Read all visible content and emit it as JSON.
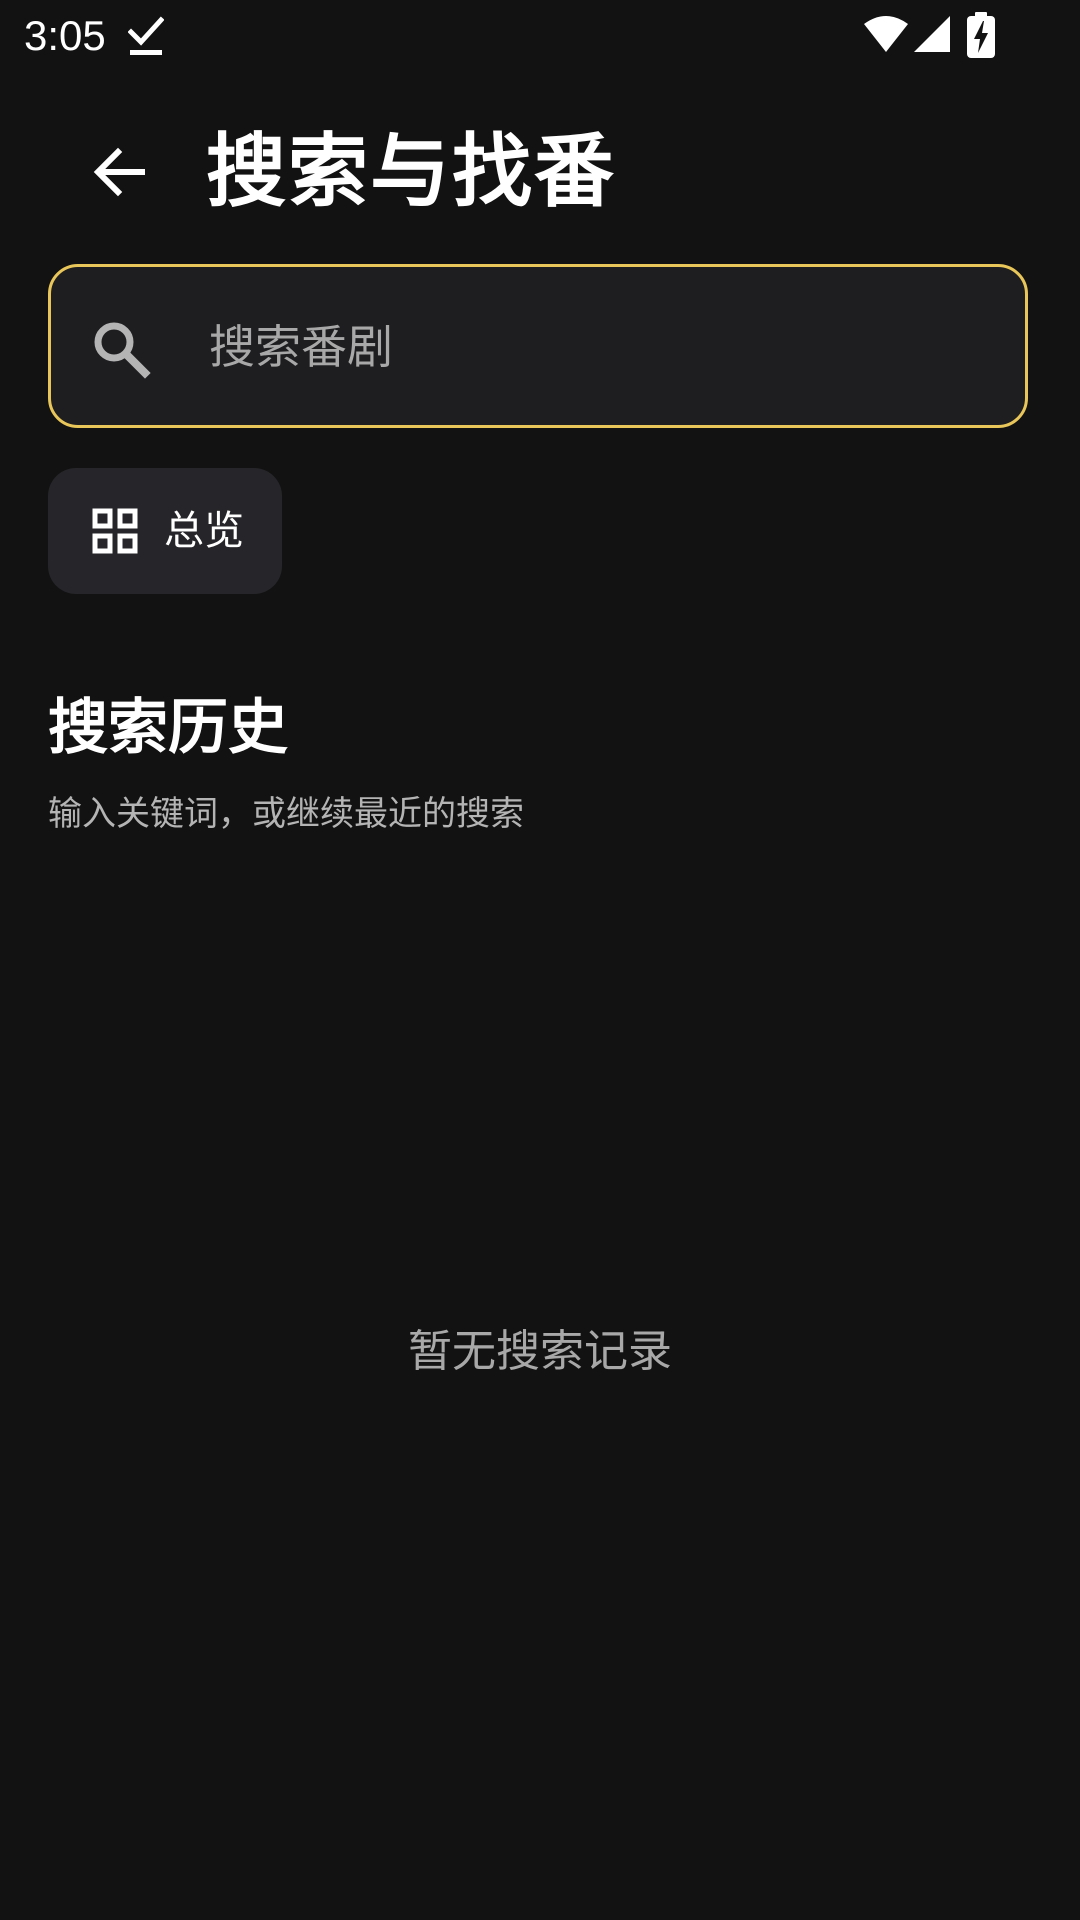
{
  "status_bar": {
    "time": "3:05",
    "icons": [
      "download-done-icon",
      "wifi-icon",
      "cellular-signal-icon",
      "battery-charging-icon"
    ]
  },
  "header": {
    "back_icon": "arrow-back-icon",
    "title": "搜索与找番"
  },
  "search": {
    "icon": "search-icon",
    "placeholder": "搜索番剧",
    "value": "",
    "border_color": "#e8c65a"
  },
  "chips": [
    {
      "icon": "grid-view-icon",
      "label": "总览"
    }
  ],
  "history": {
    "title": "搜索历史",
    "subtitle": "输入关键词，或继续最近的搜索",
    "empty_text": "暂无搜索记录"
  },
  "colors": {
    "background": "#121212",
    "surface": "#1e1e21",
    "chip_background": "#26262a",
    "accent": "#e8c65a"
  }
}
